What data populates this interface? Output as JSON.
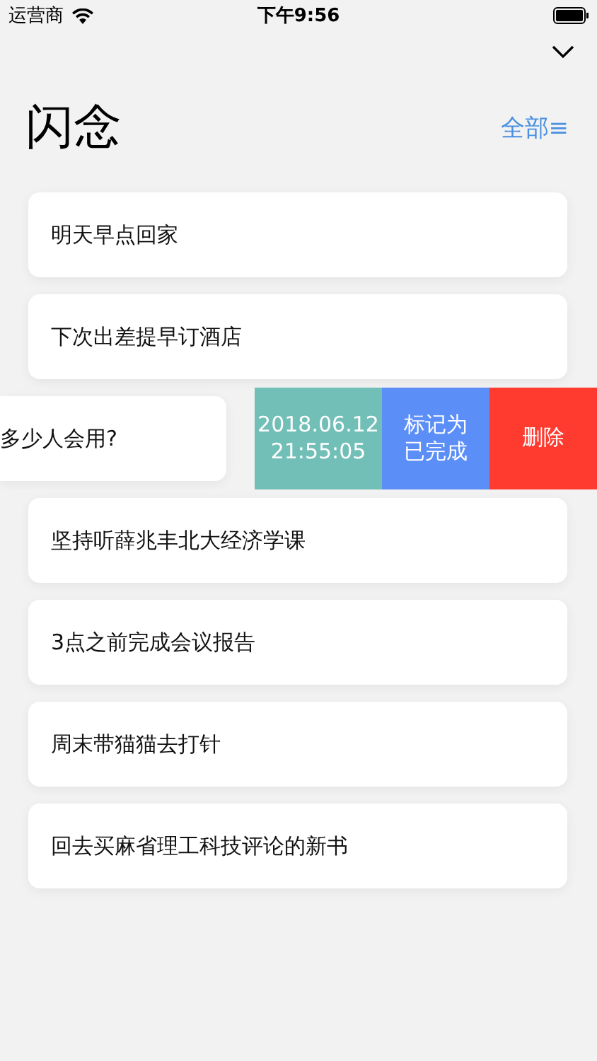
{
  "status_bar": {
    "carrier": "运营商",
    "time": "下午9:56"
  },
  "title": "闪念",
  "filter": {
    "label": "全部≡"
  },
  "notes": [
    {
      "kind": "card",
      "text": "明天早点回家"
    },
    {
      "kind": "card",
      "text": "下次出差提早订酒店"
    },
    {
      "kind": "swiped",
      "text": "多少人会用?",
      "actions": [
        {
          "kind": "timestamp",
          "lines": [
            "2018.06.12",
            "21:55:05"
          ],
          "color": "#72bfb8"
        },
        {
          "kind": "button",
          "lines": [
            "标记为",
            "已完成"
          ],
          "color": "#5b8ef7"
        },
        {
          "kind": "button",
          "lines": [
            "删除"
          ],
          "color": "#ff3b30"
        }
      ]
    },
    {
      "kind": "card",
      "text": "坚持听薛兆丰北大经济学课"
    },
    {
      "kind": "card",
      "text": "3点之前完成会议报告"
    },
    {
      "kind": "card",
      "text": "周末带猫猫去打针"
    },
    {
      "kind": "card",
      "text": "回去买麻省理工科技评论的新书"
    }
  ]
}
